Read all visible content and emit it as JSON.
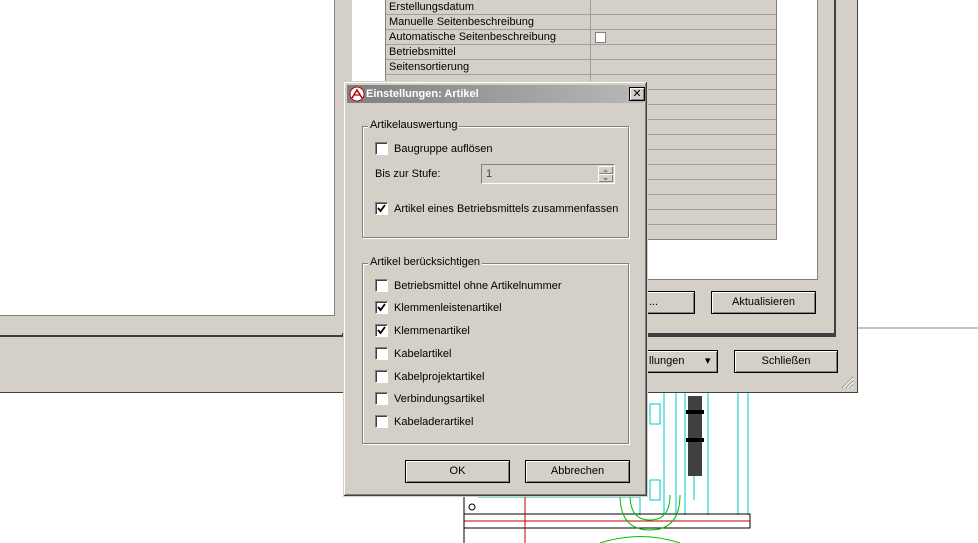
{
  "background_window": {
    "properties": [
      {
        "name": "Erstellungsdatum",
        "checkbox": false
      },
      {
        "name": "Manuelle Seitenbeschreibung",
        "checkbox": false
      },
      {
        "name": "Automatische Seitenbeschreibung",
        "checkbox": true
      },
      {
        "name": "Betriebsmittel",
        "checkbox": false
      },
      {
        "name": "Seitensortierung",
        "checkbox": false
      }
    ],
    "partial_button_label": "...",
    "refresh_label": "Aktualisieren",
    "settings_label": "llungen",
    "close_label": "Schließen"
  },
  "dialog": {
    "title": "Einstellungen: Artikel",
    "close_glyph": "✕",
    "group1": {
      "legend": "Artikelauswertung",
      "resolve_assembly": {
        "label": "Baugruppe auflösen",
        "checked": false
      },
      "stage_label": "Bis zur Stufe:",
      "stage_value": "1",
      "combine": {
        "label": "Artikel eines Betriebsmittels zusammenfassen",
        "checked": true
      }
    },
    "group2": {
      "legend": "Artikel berücksichtigen",
      "items": [
        {
          "label": "Betriebsmittel ohne Artikelnummer",
          "checked": false
        },
        {
          "label": "Klemmenleistenartikel",
          "checked": true
        },
        {
          "label": "Klemmenartikel",
          "checked": true
        },
        {
          "label": "Kabelartikel",
          "checked": false
        },
        {
          "label": "Kabelprojektartikel",
          "checked": false
        },
        {
          "label": "Verbindungsartikel",
          "checked": false
        },
        {
          "label": "Kabeladerartikel",
          "checked": false
        }
      ]
    },
    "ok_label": "OK",
    "cancel_label": "Abbrechen"
  }
}
